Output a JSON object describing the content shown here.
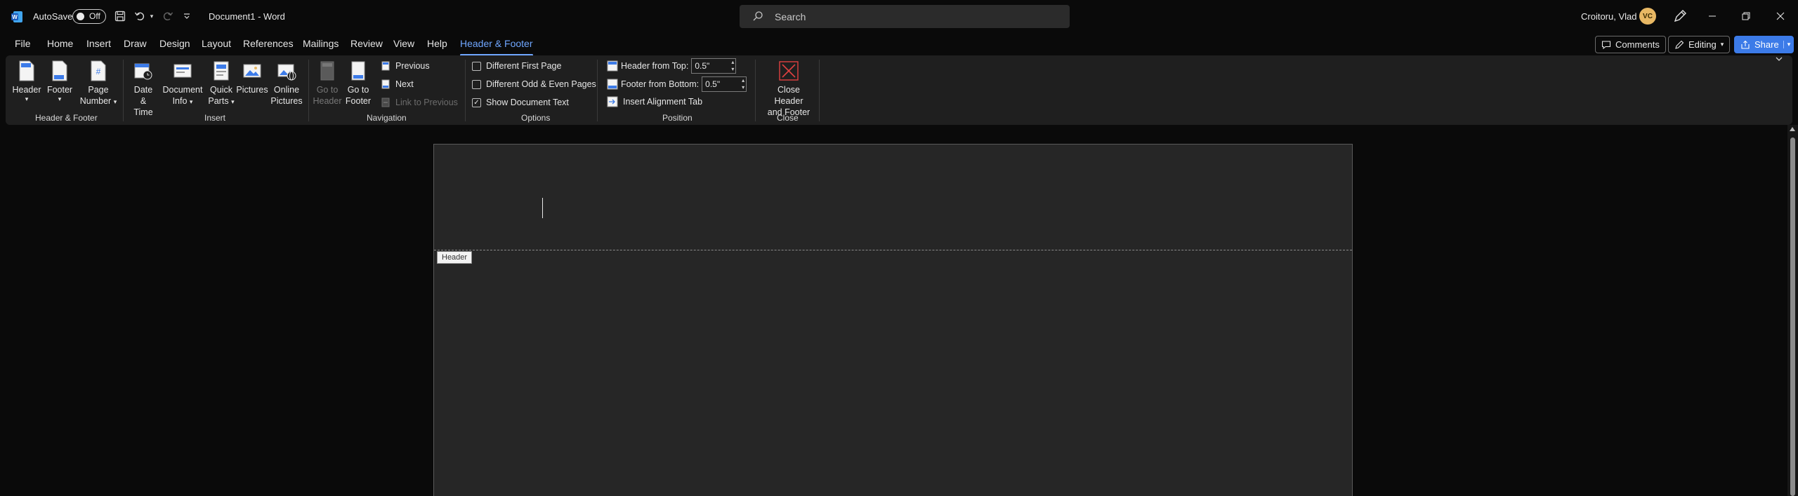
{
  "titlebar": {
    "autosave_label": "AutoSave",
    "autosave_state": "Off",
    "doc_title": "Document1  -  Word",
    "search_placeholder": "Search",
    "user_name": "Croitoru, Vlad",
    "user_initials": "VC"
  },
  "tabs": [
    "File",
    "Home",
    "Insert",
    "Draw",
    "Design",
    "Layout",
    "References",
    "Mailings",
    "Review",
    "View",
    "Help",
    "Header & Footer"
  ],
  "active_tab": "Header & Footer",
  "top_buttons": {
    "comments": "Comments",
    "editing": "Editing",
    "share": "Share"
  },
  "ribbon": {
    "header_footer": {
      "label": "Header & Footer",
      "header": "Header",
      "footer": "Footer",
      "page_number_1": "Page",
      "page_number_2": "Number"
    },
    "insert": {
      "label": "Insert",
      "date_time_1": "Date &",
      "date_time_2": "Time",
      "document_info_1": "Document",
      "document_info_2": "Info",
      "quick_parts_1": "Quick",
      "quick_parts_2": "Parts",
      "pictures": "Pictures",
      "online_pictures_1": "Online",
      "online_pictures_2": "Pictures"
    },
    "navigation": {
      "label": "Navigation",
      "go_to_header_1": "Go to",
      "go_to_header_2": "Header",
      "go_to_footer_1": "Go to",
      "go_to_footer_2": "Footer",
      "previous": "Previous",
      "next": "Next",
      "link_to_previous": "Link to Previous"
    },
    "options": {
      "label": "Options",
      "different_first_page": "Different First Page",
      "different_odd_even": "Different Odd & Even Pages",
      "show_document_text": "Show Document Text"
    },
    "position": {
      "label": "Position",
      "header_from_top": "Header from Top:",
      "header_from_top_value": "0.5\"",
      "footer_from_bottom": "Footer from Bottom:",
      "footer_from_bottom_value": "0.5\"",
      "insert_alignment_tab": "Insert Alignment Tab"
    },
    "close": {
      "label": "Close",
      "close_1": "Close Header",
      "close_2": "and Footer"
    }
  },
  "document": {
    "header_tag": "Header"
  },
  "colors": {
    "accent": "#6fa6ff",
    "share": "#3c7be8",
    "close_red": "#e04040"
  }
}
